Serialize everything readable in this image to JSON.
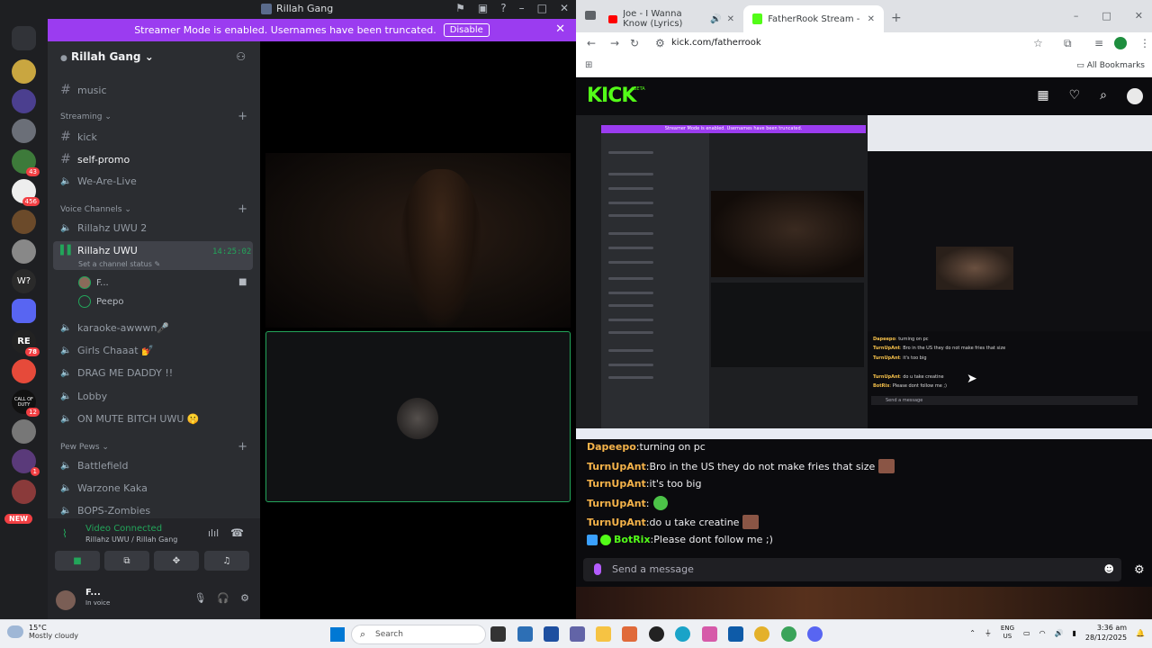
{
  "discord": {
    "title": "Rillah Gang",
    "banner": {
      "text": "Streamer Mode is enabled. Usernames have been truncated.",
      "button": "Disable"
    },
    "server_name": "Rillah Gang",
    "channels": [
      {
        "label": "music"
      },
      {
        "label": "kick"
      },
      {
        "label": "self-promo"
      },
      {
        "label": "We-Are-Live"
      },
      {
        "label": "Rillahz UWU 2"
      },
      {
        "label": "Rillahz UWU"
      },
      {
        "label": "karaoke-awwwn🎤"
      },
      {
        "label": "Girls Chaaat 💅"
      },
      {
        "label": "DRAG ME DADDY !!"
      },
      {
        "label": "Lobby"
      },
      {
        "label": "ON MUTE BITCH UWU 🤫"
      },
      {
        "label": "Battlefield"
      },
      {
        "label": "Warzone Kaka"
      },
      {
        "label": "BOPS-Zombies"
      }
    ],
    "categories": {
      "streaming": "Streaming",
      "voice": "Voice Channels",
      "pew": "Pew Pews"
    },
    "active_channel_time": "14:25:02",
    "channel_status": "Set a channel status",
    "members": [
      "F...",
      "Peepo"
    ],
    "guild_badges": [
      "43",
      "456",
      "78",
      "12",
      "1"
    ],
    "new_badge": "NEW",
    "guild_labels": {
      "w": "W?",
      "re": "RE",
      "cod": "CALL OF DUTY"
    },
    "voice": {
      "title": "Video Connected",
      "sub": "Rillahz UWU / Rillah Gang"
    },
    "user": {
      "name": "F...",
      "status": "In voice"
    }
  },
  "chrome": {
    "tabs": [
      {
        "label": "Joe - I Wanna Know (Lyrics)"
      },
      {
        "label": "FatherRook Stream - Watch Live"
      }
    ],
    "url": "kick.com/fatherrook",
    "bookmarks_label": "All Bookmarks",
    "kick_logo": "KICK",
    "kick_beta": "BETA"
  },
  "chat": {
    "messages": [
      {
        "user": "Dapeepo",
        "text": "turning on pc"
      },
      {
        "user": "TurnUpAnt",
        "text": "Bro in the US they do not make fries that size"
      },
      {
        "user": "TurnUpAnt",
        "text": "it's too big"
      },
      {
        "user": "TurnUpAnt",
        "text": ""
      },
      {
        "user": "TurnUpAnt",
        "text": "do u take creatine"
      },
      {
        "user": "BotRix",
        "text": "Please dont follow me ;)"
      }
    ],
    "placeholder": "Send a message"
  },
  "nested": {
    "banner": "Streamer Mode is enabled. Usernames have been truncated.",
    "msgs": [
      {
        "user": "Dapeepo",
        "text": "turning on pc"
      },
      {
        "user": "TurnUpAnt",
        "text": "Bro in the US they do not make fries that size"
      },
      {
        "user": "TurnUpAnt",
        "text": "it's too big"
      },
      {
        "user": "TurnUpAnt",
        "text": "do u take creatine"
      },
      {
        "user": "BotRix",
        "text": "Please dont follow me ;)"
      }
    ],
    "placeholder": "Send a message"
  },
  "taskbar": {
    "weather_temp": "15°C",
    "weather_desc": "Mostly cloudy",
    "search": "Search",
    "lang1": "ENG",
    "lang2": "US",
    "time": "3:36 am",
    "date": "28/12/2025"
  },
  "colors": {
    "discord_accent": "#9b3cf0",
    "kick_green": "#53fc18",
    "voice_green": "#23a55a"
  }
}
